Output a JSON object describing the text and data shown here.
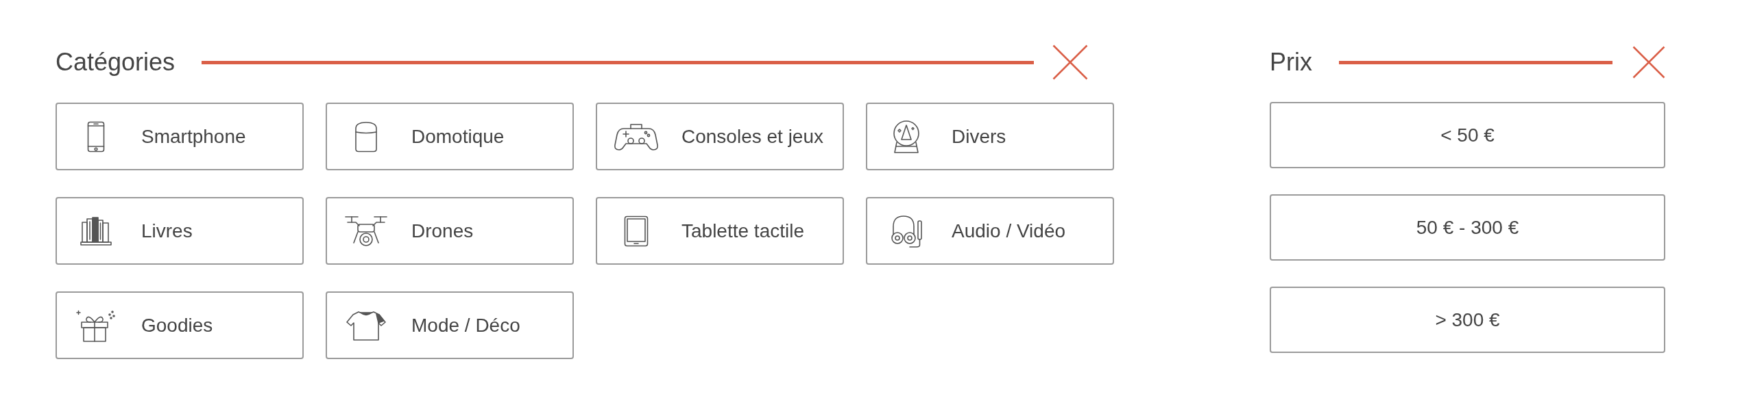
{
  "categories": {
    "title": "Catégories",
    "items": [
      {
        "label": "Smartphone"
      },
      {
        "label": "Domotique"
      },
      {
        "label": "Consoles et jeux"
      },
      {
        "label": "Divers"
      },
      {
        "label": "Livres"
      },
      {
        "label": "Drones"
      },
      {
        "label": "Tablette tactile"
      },
      {
        "label": "Audio / Vidéo"
      },
      {
        "label": "Goodies"
      },
      {
        "label": "Mode / Déco"
      }
    ]
  },
  "price": {
    "title": "Prix",
    "items": [
      {
        "label": "< 50 €"
      },
      {
        "label": "50 € - 300 €"
      },
      {
        "label": "> 300 €"
      }
    ]
  }
}
